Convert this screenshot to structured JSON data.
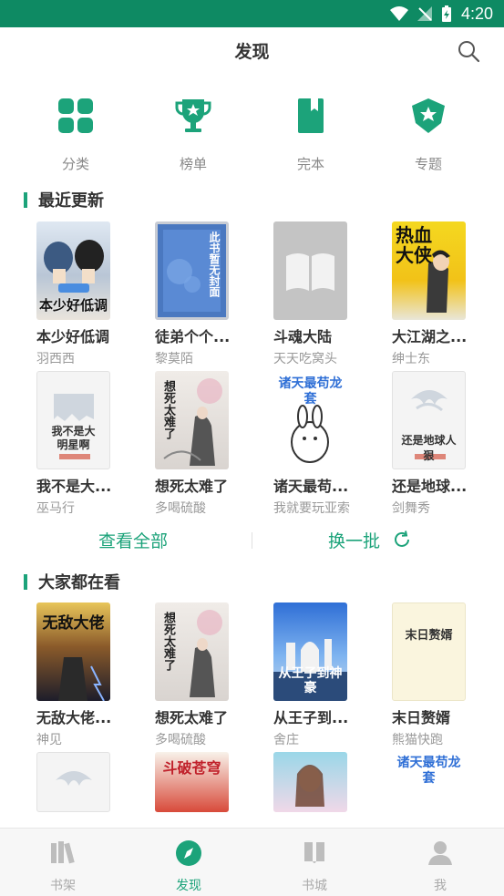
{
  "status_bar": {
    "time": "4:20"
  },
  "header": {
    "title": "发现"
  },
  "categories": [
    {
      "label": "分类",
      "icon": "grid-icon"
    },
    {
      "label": "榜单",
      "icon": "trophy-icon"
    },
    {
      "label": "完本",
      "icon": "bookmark-book-icon"
    },
    {
      "label": "专题",
      "icon": "shield-star-icon"
    }
  ],
  "recent": {
    "title": "最近更新",
    "books": [
      {
        "name": "本少好低调",
        "author": "羽西西",
        "cover_text": "本少好低调"
      },
      {
        "name": "徒弟个个...",
        "author": "黎莫陌",
        "cover_text": "此书暂无封面"
      },
      {
        "name": "斗魂大陆",
        "author": "天天吃窝头",
        "cover_text": ""
      },
      {
        "name": "大江湖之...",
        "author": "绅士东",
        "cover_text": "热血大侠"
      },
      {
        "name": "我不是大...",
        "author": "巫马行",
        "cover_text": "我不是大明星啊"
      },
      {
        "name": "想死太难了",
        "author": "多喝硫酸",
        "cover_text": "想死太难了"
      },
      {
        "name": "诸天最苟...",
        "author": "我就要玩亚索",
        "cover_text": "诸天最苟龙套"
      },
      {
        "name": "还是地球...",
        "author": "剑舞秀",
        "cover_text": "还是地球人狠"
      }
    ]
  },
  "actions": {
    "view_all": "查看全部",
    "refresh": "换一批"
  },
  "popular": {
    "title": "大家都在看",
    "books": [
      {
        "name": "无敌大佬...",
        "author": "神见",
        "cover_text": "无敌大佬"
      },
      {
        "name": "想死太难了",
        "author": "多喝硫酸",
        "cover_text": "想死太难了"
      },
      {
        "name": "从王子到...",
        "author": "舍庄",
        "cover_text": "从王子到神豪"
      },
      {
        "name": "末日赘婿",
        "author": "熊猫快跑",
        "cover_text": "末日赘婿"
      }
    ],
    "partial_covers": [
      "",
      "斗破苍穹",
      "",
      "诸天最苟龙套"
    ]
  },
  "bottom_nav": [
    {
      "label": "书架",
      "icon": "bookshelf-icon"
    },
    {
      "label": "发现",
      "icon": "compass-icon",
      "active": true
    },
    {
      "label": "书城",
      "icon": "book-store-icon"
    },
    {
      "label": "我",
      "icon": "user-icon"
    }
  ],
  "colors": {
    "accent": "#1ca37a",
    "status_bar": "#0e8a63",
    "muted": "#999999"
  }
}
